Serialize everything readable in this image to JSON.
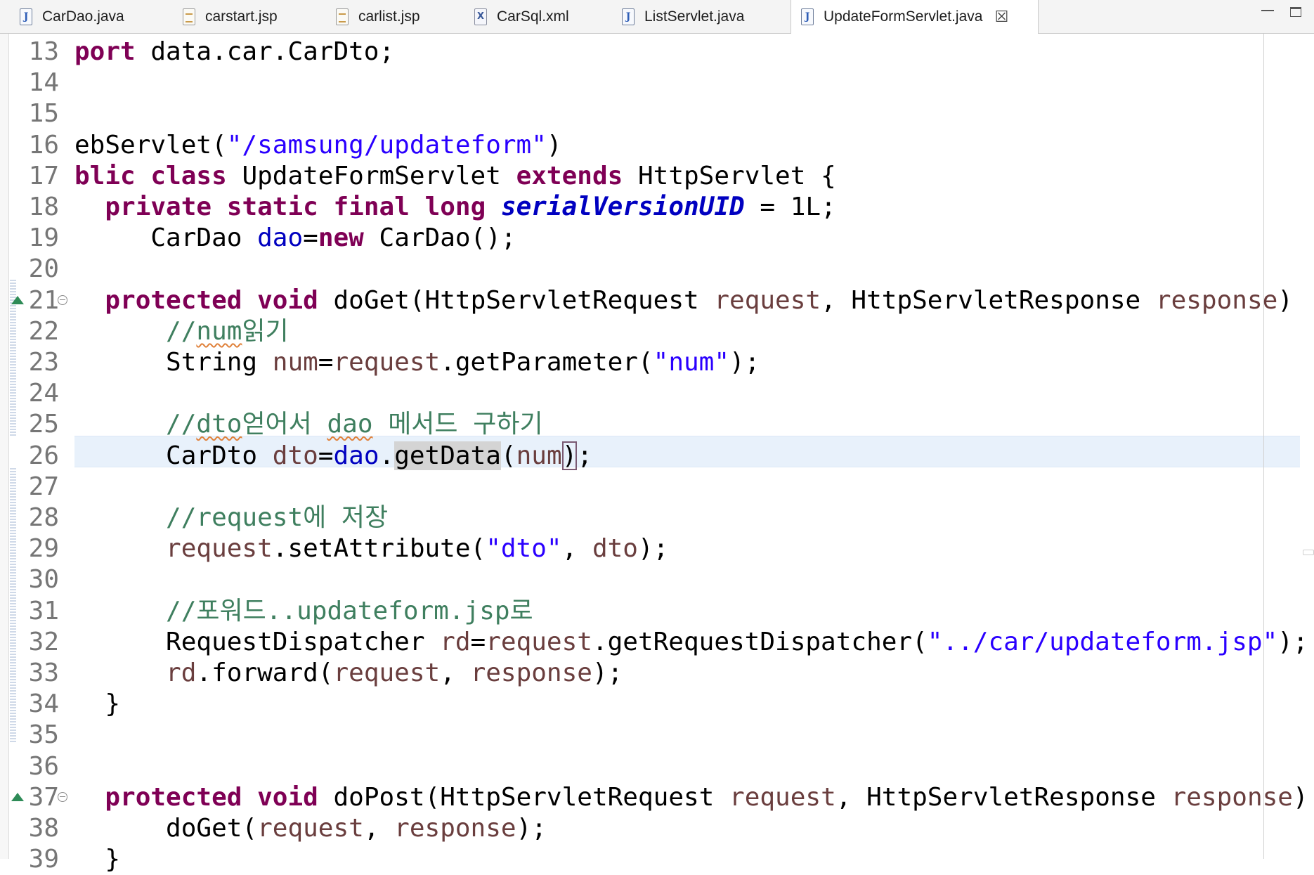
{
  "tabs": [
    {
      "label": "CarDao.java",
      "icon": "java-file-icon",
      "active": false
    },
    {
      "label": "carstart.jsp",
      "icon": "jsp-file-icon",
      "active": false
    },
    {
      "label": "carlist.jsp",
      "icon": "jsp-file-icon",
      "active": false
    },
    {
      "label": "CarSql.xml",
      "icon": "xml-file-icon",
      "active": false
    },
    {
      "label": "ListServlet.java",
      "icon": "java-file-icon",
      "active": false
    },
    {
      "label": "UpdateFormServlet.java",
      "icon": "java-file-icon",
      "active": true
    }
  ],
  "editor": {
    "current_line": "26",
    "lines": [
      {
        "num": "13",
        "tokens": [
          [
            "kw",
            "port"
          ],
          [
            "t",
            " data.car.CarDto;"
          ]
        ]
      },
      {
        "num": "14",
        "tokens": []
      },
      {
        "num": "15",
        "tokens": []
      },
      {
        "num": "16",
        "tokens": [
          [
            "t",
            "ebServlet("
          ],
          [
            "str",
            "\"/samsung/updateform\""
          ],
          [
            "t",
            ")"
          ]
        ]
      },
      {
        "num": "17",
        "tokens": [
          [
            "kw",
            "blic"
          ],
          [
            "t",
            " "
          ],
          [
            "kw",
            "class"
          ],
          [
            "t",
            " UpdateFormServlet "
          ],
          [
            "kw",
            "extends"
          ],
          [
            "t",
            " HttpServlet {"
          ]
        ]
      },
      {
        "num": "18",
        "tokens": [
          [
            "t",
            "  "
          ],
          [
            "kw",
            "private"
          ],
          [
            "t",
            " "
          ],
          [
            "kw",
            "static"
          ],
          [
            "t",
            " "
          ],
          [
            "kw",
            "final"
          ],
          [
            "t",
            " "
          ],
          [
            "kw",
            "long"
          ],
          [
            "t",
            " "
          ],
          [
            "sfld",
            "serialVersionUID"
          ],
          [
            "t",
            " = 1L;"
          ]
        ]
      },
      {
        "num": "19",
        "tokens": [
          [
            "t",
            "     CarDao "
          ],
          [
            "fld",
            "dao"
          ],
          [
            "t",
            "="
          ],
          [
            "kw",
            "new"
          ],
          [
            "t",
            " CarDao();"
          ]
        ]
      },
      {
        "num": "20",
        "tokens": []
      },
      {
        "num": "21",
        "override": true,
        "tokens": [
          [
            "t",
            "  "
          ],
          [
            "kw",
            "protected"
          ],
          [
            "t",
            " "
          ],
          [
            "kw",
            "void"
          ],
          [
            "t",
            " doGet(HttpServletRequest "
          ],
          [
            "var",
            "request"
          ],
          [
            "t",
            ", HttpServletResponse "
          ],
          [
            "var",
            "response"
          ],
          [
            "t",
            ")"
          ]
        ]
      },
      {
        "num": "22",
        "tokens": [
          [
            "t",
            "      "
          ],
          [
            "cmt",
            "//"
          ],
          [
            "cmt-spell",
            "num"
          ],
          [
            "cmt",
            "읽기"
          ]
        ]
      },
      {
        "num": "23",
        "tokens": [
          [
            "t",
            "      String "
          ],
          [
            "var",
            "num"
          ],
          [
            "t",
            "="
          ],
          [
            "var",
            "request"
          ],
          [
            "t",
            ".getParameter("
          ],
          [
            "str",
            "\"num\""
          ],
          [
            "t",
            ");"
          ]
        ]
      },
      {
        "num": "24",
        "tokens": []
      },
      {
        "num": "25",
        "tokens": [
          [
            "t",
            "      "
          ],
          [
            "cmt",
            "//"
          ],
          [
            "cmt-spell",
            "dto"
          ],
          [
            "cmt",
            "얻어서 "
          ],
          [
            "cmt-spell",
            "dao"
          ],
          [
            "cmt",
            " 메서드 구하기"
          ]
        ]
      },
      {
        "num": "26",
        "tokens": [
          [
            "t",
            "      CarDto "
          ],
          [
            "var",
            "dto"
          ],
          [
            "t",
            "="
          ],
          [
            "fld",
            "dao"
          ],
          [
            "t",
            "."
          ],
          [
            "occ",
            "getData"
          ],
          [
            "t",
            "("
          ],
          [
            "var",
            "num"
          ],
          [
            "bracket",
            ")"
          ],
          [
            "t",
            ";"
          ]
        ]
      },
      {
        "num": "27",
        "tokens": []
      },
      {
        "num": "28",
        "tokens": [
          [
            "t",
            "      "
          ],
          [
            "cmt",
            "//request에 저장"
          ]
        ]
      },
      {
        "num": "29",
        "tokens": [
          [
            "t",
            "      "
          ],
          [
            "var",
            "request"
          ],
          [
            "t",
            ".setAttribute("
          ],
          [
            "str",
            "\"dto\""
          ],
          [
            "t",
            ", "
          ],
          [
            "var",
            "dto"
          ],
          [
            "t",
            ");"
          ]
        ]
      },
      {
        "num": "30",
        "tokens": []
      },
      {
        "num": "31",
        "tokens": [
          [
            "t",
            "      "
          ],
          [
            "cmt",
            "//포워드..updateform.jsp로"
          ]
        ]
      },
      {
        "num": "32",
        "tokens": [
          [
            "t",
            "      RequestDispatcher "
          ],
          [
            "var",
            "rd"
          ],
          [
            "t",
            "="
          ],
          [
            "var",
            "request"
          ],
          [
            "t",
            ".getRequestDispatcher("
          ],
          [
            "str",
            "\"../car/updateform.jsp\""
          ],
          [
            "t",
            ");"
          ]
        ]
      },
      {
        "num": "33",
        "tokens": [
          [
            "t",
            "      "
          ],
          [
            "var",
            "rd"
          ],
          [
            "t",
            ".forward("
          ],
          [
            "var",
            "request"
          ],
          [
            "t",
            ", "
          ],
          [
            "var",
            "response"
          ],
          [
            "t",
            ");"
          ]
        ]
      },
      {
        "num": "34",
        "tokens": [
          [
            "t",
            "  }"
          ]
        ]
      },
      {
        "num": "35",
        "tokens": []
      },
      {
        "num": "36",
        "tokens": []
      },
      {
        "num": "37",
        "override": true,
        "tokens": [
          [
            "t",
            "  "
          ],
          [
            "kw",
            "protected"
          ],
          [
            "t",
            " "
          ],
          [
            "kw",
            "void"
          ],
          [
            "t",
            " doPost(HttpServletRequest "
          ],
          [
            "var",
            "request"
          ],
          [
            "t",
            ", HttpServletResponse "
          ],
          [
            "var",
            "response"
          ],
          [
            "t",
            ")"
          ]
        ]
      },
      {
        "num": "38",
        "tokens": [
          [
            "t",
            "      doGet("
          ],
          [
            "var",
            "request"
          ],
          [
            "t",
            ", "
          ],
          [
            "var",
            "response"
          ],
          [
            "t",
            ");"
          ]
        ]
      },
      {
        "num": "39",
        "tokens": [
          [
            "t",
            "  }"
          ]
        ]
      }
    ]
  },
  "colors": {
    "keyword": "#7f0055",
    "string": "#2a00ff",
    "field": "#0000c0",
    "variable": "#6a3e3e",
    "comment": "#3f7f5f",
    "current_line_bg": "#e8f1fb"
  }
}
